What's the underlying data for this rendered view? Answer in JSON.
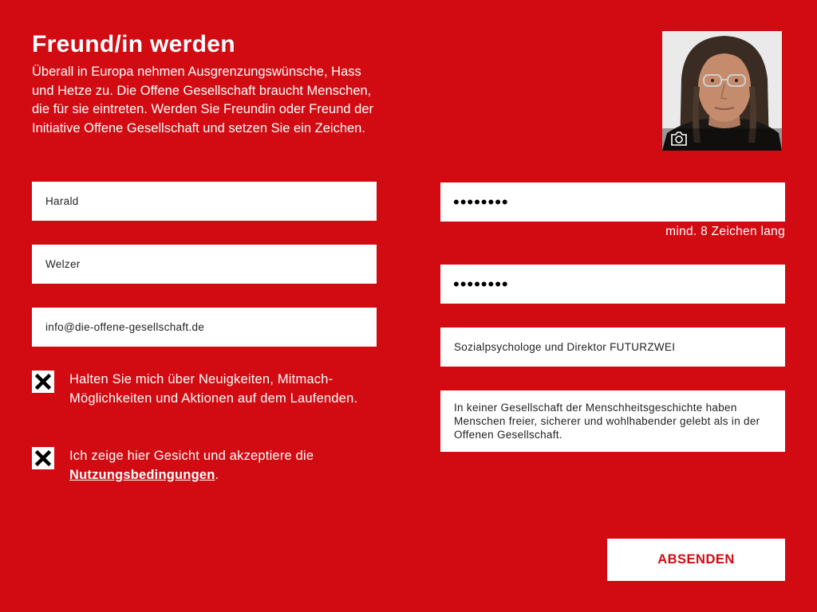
{
  "header": {
    "title": "Freund/in werden",
    "intro": "Überall in Europa nehmen Ausgrenzungswünsche, Hass und Hetze zu. Die Offene Gesellschaft braucht Menschen, die für sie eintreten. Werden Sie Freundin oder Freund der Initiative Offene Gesellschaft und setzen Sie ein Zeichen."
  },
  "photo": {
    "camera_icon": "camera-icon"
  },
  "form": {
    "first_name": "Harald",
    "last_name": "Welzer",
    "email": "info@die-offene-gesellschaft.de",
    "password": "••••••••",
    "password_hint": "mind. 8 Zeichen lang",
    "password_confirm": "••••••••",
    "occupation": "Sozialpsychologe und Direktor FUTURZWEI",
    "statement": "In keiner Gesellschaft der Menschheitsgeschichte haben Menschen freier, sicherer und wohlhabender gelebt als in der Offenen Gesellschaft."
  },
  "consents": {
    "newsletter_label": "Halten Sie mich über Neuigkeiten, Mitmach-Möglichkeiten und Aktionen auf dem Laufenden.",
    "newsletter_checked": true,
    "terms_prefix": "Ich zeige hier Gesicht und akzeptiere die",
    "terms_link": "Nutzungsbedingungen",
    "terms_suffix": ".",
    "terms_checked": true
  },
  "actions": {
    "submit_label": "ABSENDEN"
  },
  "colors": {
    "background": "#d20a11",
    "field": "#ffffff",
    "button_text": "#d20a11"
  }
}
